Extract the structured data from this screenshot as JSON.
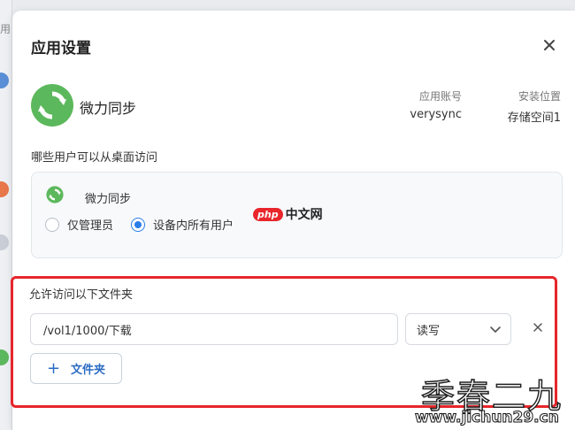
{
  "background": {
    "partial_text": "用"
  },
  "dialog": {
    "title": "应用设置"
  },
  "app": {
    "name": "微力同步",
    "account_label": "应用账号",
    "account_value": "verysync",
    "location_label": "安装位置",
    "location_value": "存储空间1"
  },
  "access": {
    "section_title": "哪些用户可以从桌面访问",
    "app_name": "微力同步",
    "options": [
      {
        "label": "仅管理员",
        "selected": false
      },
      {
        "label": "设备内所有用户",
        "selected": true
      }
    ]
  },
  "folders": {
    "section_title": "允许访问以下文件夹",
    "items": [
      {
        "path": "/vol1/1000/下载",
        "permission": "读写"
      }
    ],
    "add_button_label": "文件夹"
  },
  "watermarks": {
    "php_badge": "php",
    "php_text": "中文网",
    "big_text": "季春二九",
    "url": "www.jichun29.cn"
  },
  "colors": {
    "accent": "#2b7de9",
    "highlight_border": "#e6262b",
    "app_green": "#5cb85c"
  },
  "icons": {
    "app": "sync-app-icon",
    "close": "close-icon",
    "remove": "remove-icon",
    "dropdown": "chevron-down-icon",
    "add": "plus-icon"
  }
}
